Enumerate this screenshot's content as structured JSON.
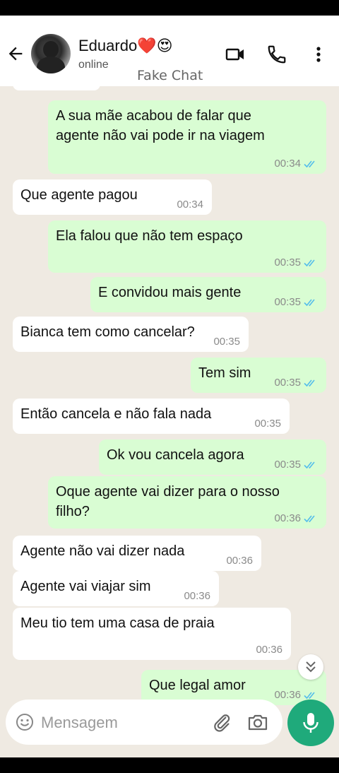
{
  "header": {
    "contact_name": "Eduardo",
    "contact_emojis": "❤️😍",
    "status": "online",
    "watermark": "Fake Chat",
    "icons": [
      "back-arrow-icon",
      "video-call-icon",
      "phone-icon",
      "more-vert-icon"
    ]
  },
  "messages": [
    {
      "dir": "out",
      "text": "A sua mãe acabou de falar que\nagente não vai pode ir na viagem",
      "time": "00:34",
      "read": true
    },
    {
      "dir": "in",
      "text": "Que agente pagou",
      "time": "00:34"
    },
    {
      "dir": "out",
      "text": "Ela falou que não tem espaço",
      "time": "00:35",
      "read": true
    },
    {
      "dir": "out",
      "text": "E convidou mais gente",
      "time": "00:35",
      "read": true
    },
    {
      "dir": "in",
      "text": "Bianca tem como cancelar?",
      "time": "00:35"
    },
    {
      "dir": "out",
      "text": "Tem sim",
      "time": "00:35",
      "read": true
    },
    {
      "dir": "in",
      "text": "Então cancela e não fala nada",
      "time": "00:35"
    },
    {
      "dir": "out",
      "text": "Ok vou cancela agora",
      "time": "00:35",
      "read": true
    },
    {
      "dir": "out",
      "text": "Oque agente vai dizer para o nosso\nfilho?",
      "time": "00:36",
      "read": true
    },
    {
      "dir": "in",
      "text": "Agente não vai dizer nada",
      "time": "00:36"
    },
    {
      "dir": "in",
      "text": "Agente vai viajar sim",
      "time": "00:36"
    },
    {
      "dir": "in",
      "text": "Meu tio tem uma casa de praia",
      "time": "00:36"
    },
    {
      "dir": "out",
      "text": "Que legal amor",
      "time": "00:36",
      "read": true
    }
  ],
  "composer": {
    "placeholder": "Mensagem",
    "icons": [
      "emoji-icon",
      "attach-icon",
      "camera-icon",
      "mic-icon"
    ]
  },
  "colors": {
    "outgoing_bubble": "#d9fdd3",
    "incoming_bubble": "#ffffff",
    "chat_background": "#efeae2",
    "read_ticks": "#53bdeb",
    "mic_button": "#1faa7b"
  }
}
